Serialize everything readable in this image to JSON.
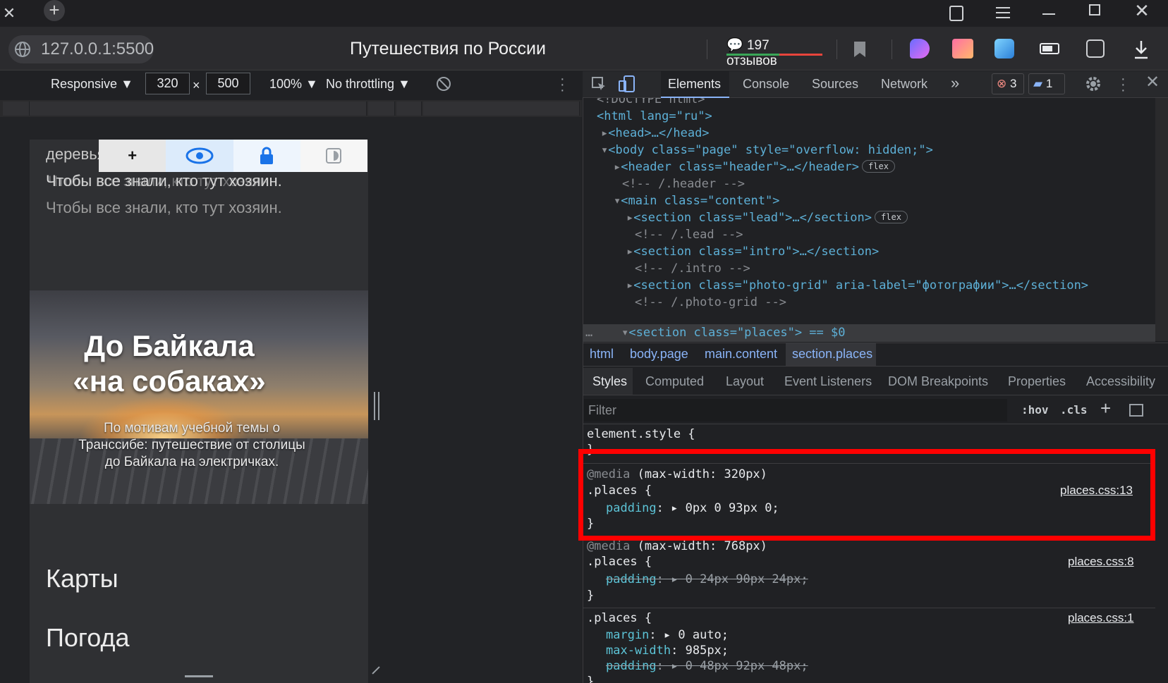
{
  "browser": {
    "url": "127.0.0.1:5500",
    "title": "Путешествия по России",
    "reviews": "197 отзывов",
    "close_glyph": "✕",
    "newtab_glyph": "+"
  },
  "device_toolbar": {
    "mode": "Responsive",
    "width": "320",
    "times": "×",
    "height": "500",
    "zoom": "100%",
    "throttling": "No throttling"
  },
  "page": {
    "line1": "деревья",
    "line2": "Чтобы все знали, кто тут хозяин.",
    "line3": "Чтобы все знали, кто тут хозяин.",
    "hero_title_1": "До Байкала",
    "hero_title_2": "«на собаках»",
    "hero_sub_1": "По мотивам учебной темы о",
    "hero_sub_2": "Транссибе: путешествие от столицы",
    "hero_sub_3": "до Байкала на электричках.",
    "nav_1": "Карты",
    "nav_2": "Погода",
    "toggle_plus": "+"
  },
  "devtools": {
    "tabs": [
      "Elements",
      "Console",
      "Sources",
      "Network",
      "»"
    ],
    "errors": "3",
    "messages": "1",
    "dom": [
      "<!DOCTYPE html>",
      "<html lang=\"ru\">",
      "<head>…</head>",
      "<body class=\"page\" style=\"overflow: hidden;\">",
      "<header class=\"header\">…</header>",
      "<!-- /.header -->",
      "<main class=\"content\">",
      "<section class=\"lead\">…</section>",
      "<!-- /.lead -->",
      "<section class=\"intro\">…</section>",
      "<!-- /.intro -->",
      "<section class=\"photo-grid\" aria-label=\"фотографии\">…</section>",
      "<!-- /.photo-grid -->",
      "<section class=\"places\"> == $0"
    ],
    "pill_flex": "flex",
    "crumbs": [
      "html",
      "body.page",
      "main.content",
      "section.places"
    ],
    "style_tabs": [
      "Styles",
      "Computed",
      "Layout",
      "Event Listeners",
      "DOM Breakpoints",
      "Properties",
      "Accessibility"
    ],
    "filter_placeholder": "Filter",
    "hov": ":hov",
    "cls": ".cls",
    "rules": {
      "element_style": "element.style {",
      "close": "}",
      "r1_media": "(max-width: 320px)",
      "r1_selector": ".places {",
      "r1_source": "places.css:13",
      "r1_prop": "padding",
      "r1_value": "0px 0 93px 0;",
      "r2_media": "(max-width: 768px)",
      "r2_selector": ".places {",
      "r2_source": "places.css:8",
      "r2_prop": "padding",
      "r2_value": "0 24px 90px 24px;",
      "r3_selector": ".places {",
      "r3_source": "places.css:1",
      "r3_margin": "margin",
      "r3_margin_val": "0 auto;",
      "r3_maxw": "max-width",
      "r3_maxw_val": "985px;",
      "r3_padding": "padding",
      "r3_padding_val": "0 48px 92px 48px;",
      "media_kw": "@media"
    }
  }
}
